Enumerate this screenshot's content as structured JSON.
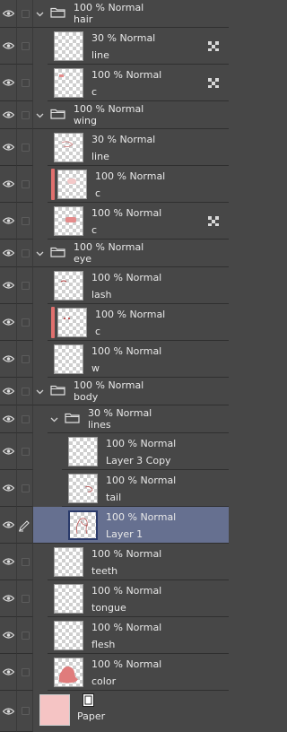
{
  "layers": {
    "hair": {
      "mode": "100 % Normal",
      "name": "hair"
    },
    "hair_line": {
      "mode": "30 % Normal",
      "name": "line"
    },
    "hair_c": {
      "mode": "100 % Normal",
      "name": "c"
    },
    "wing": {
      "mode": "100 % Normal",
      "name": "wing"
    },
    "wing_line": {
      "mode": "30 % Normal",
      "name": "line"
    },
    "wing_c1": {
      "mode": "100 % Normal",
      "name": "c"
    },
    "wing_c2": {
      "mode": "100 % Normal",
      "name": "c"
    },
    "eye": {
      "mode": "100 % Normal",
      "name": "eye"
    },
    "eye_lash": {
      "mode": "100 % Normal",
      "name": "lash"
    },
    "eye_c": {
      "mode": "100 % Normal",
      "name": "c"
    },
    "eye_w": {
      "mode": "100 % Normal",
      "name": "w"
    },
    "body": {
      "mode": "100 % Normal",
      "name": "body"
    },
    "lines": {
      "mode": "30 % Normal",
      "name": "lines"
    },
    "layer3copy": {
      "mode": "100 % Normal",
      "name": "Layer 3 Copy"
    },
    "tail": {
      "mode": "100 % Normal",
      "name": "tail"
    },
    "layer1": {
      "mode": "100 % Normal",
      "name": "Layer 1"
    },
    "teeth": {
      "mode": "100 % Normal",
      "name": "teeth"
    },
    "tongue": {
      "mode": "100 % Normal",
      "name": "tongue"
    },
    "flesh": {
      "mode": "100 % Normal",
      "name": "flesh"
    },
    "color": {
      "mode": "100 % Normal",
      "name": "color"
    },
    "paper": {
      "name": "Paper"
    }
  },
  "colors": {
    "panel_bg": "#474747",
    "selected_bg": "#667090",
    "accent_red": "#e0706e",
    "paper_color": "#f5c4c4"
  },
  "icons": {
    "visibility": "eye-icon",
    "folder": "folder-icon",
    "expand": "chevron-down-icon",
    "clip_mask": "clip-mask-icon",
    "edit": "pen-icon",
    "paper": "paper-icon"
  }
}
